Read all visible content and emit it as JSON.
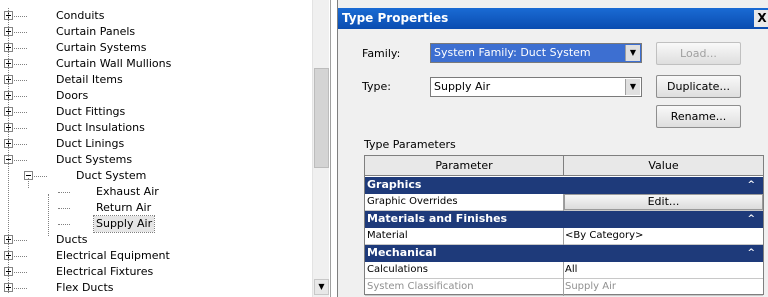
{
  "tree": {
    "items": [
      {
        "label": "Conduits",
        "expander": "plus"
      },
      {
        "label": "Curtain Panels",
        "expander": "plus"
      },
      {
        "label": "Curtain Systems",
        "expander": "plus"
      },
      {
        "label": "Curtain Wall Mullions",
        "expander": "plus"
      },
      {
        "label": "Detail Items",
        "expander": "plus"
      },
      {
        "label": "Doors",
        "expander": "plus"
      },
      {
        "label": "Duct Fittings",
        "expander": "plus"
      },
      {
        "label": "Duct Insulations",
        "expander": "plus"
      },
      {
        "label": "Duct Linings",
        "expander": "plus"
      },
      {
        "label": "Duct Systems",
        "expander": "minus"
      },
      {
        "label": "Duct System",
        "expander": "minus"
      },
      {
        "label": "Exhaust Air",
        "expander": "none"
      },
      {
        "label": "Return Air",
        "expander": "none"
      },
      {
        "label": "Supply Air",
        "expander": "none",
        "selected": true
      },
      {
        "label": "Ducts",
        "expander": "plus"
      },
      {
        "label": "Electrical Equipment",
        "expander": "plus"
      },
      {
        "label": "Electrical Fixtures",
        "expander": "plus"
      },
      {
        "label": "Flex Ducts",
        "expander": "plus"
      }
    ]
  },
  "dialog": {
    "title": "Type Properties",
    "close_label": "X",
    "family_label": "Family:",
    "family_value": "System Family: Duct System",
    "type_label": "Type:",
    "type_value": "Supply Air",
    "load_button": "Load...",
    "duplicate_button": "Duplicate...",
    "rename_button": "Rename...",
    "type_parameters_label": "Type Parameters",
    "grid": {
      "col_parameter": "Parameter",
      "col_value": "Value",
      "sections": [
        {
          "title": "Graphics",
          "rows": [
            {
              "name": "Graphic Overrides",
              "value": "Edit...",
              "is_button": true
            }
          ]
        },
        {
          "title": "Materials and Finishes",
          "rows": [
            {
              "name": "Material",
              "value": "<By Category>"
            }
          ]
        },
        {
          "title": "Mechanical",
          "rows": [
            {
              "name": "Calculations",
              "value": "All"
            },
            {
              "name": "System Classification",
              "value": "Supply Air",
              "muted": true
            }
          ]
        }
      ],
      "collapse_glyph": "^"
    }
  },
  "colors": {
    "section_header": "#1e3a7a",
    "titlebar": "#0a4cb0",
    "selection_combo": "#3d6fd1"
  }
}
